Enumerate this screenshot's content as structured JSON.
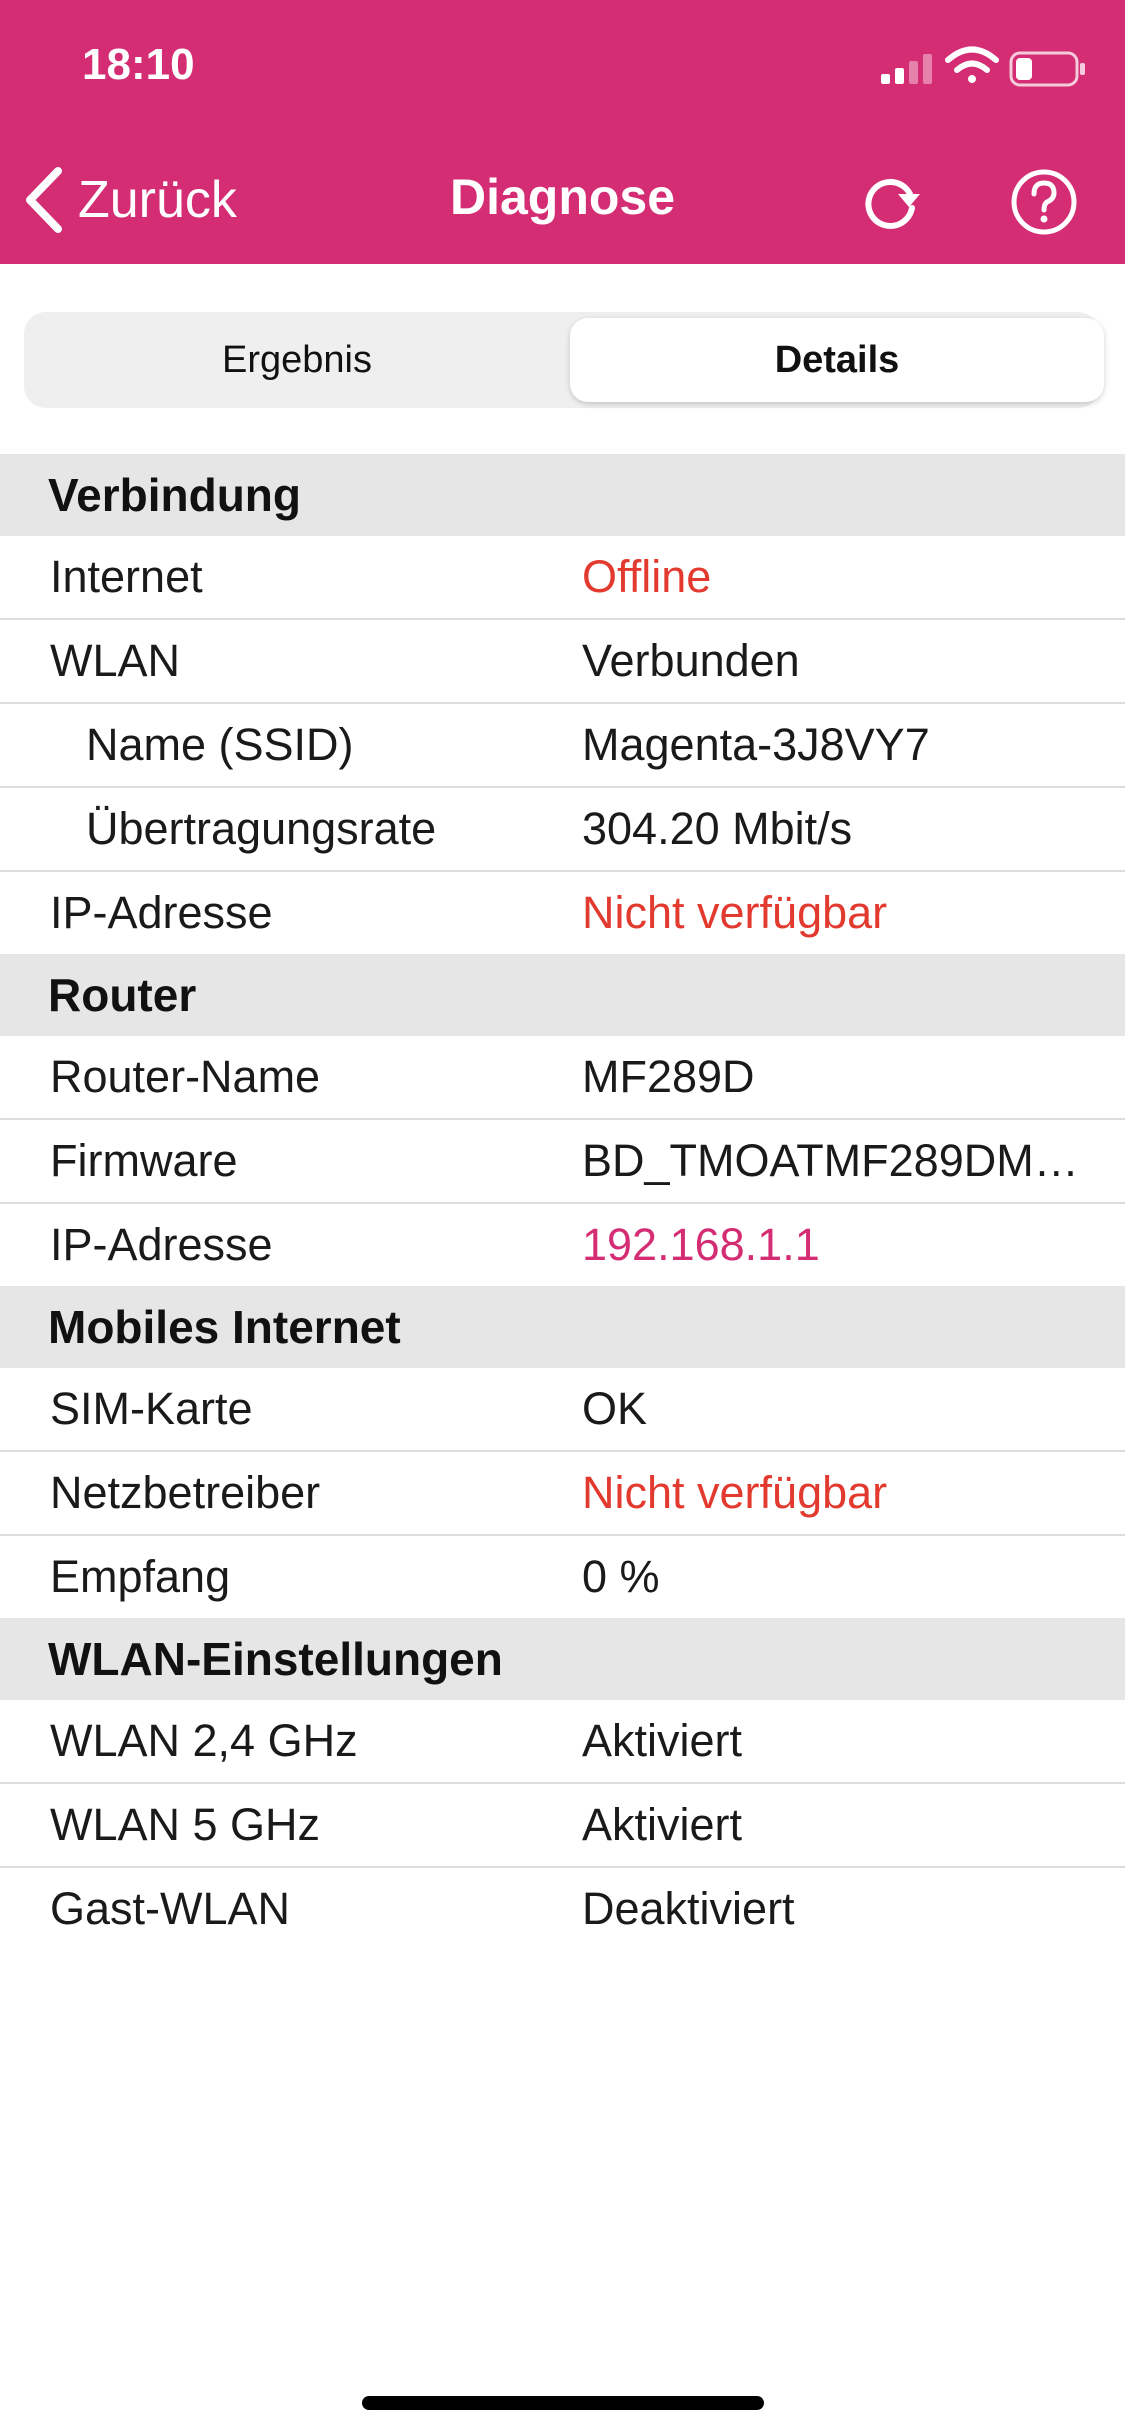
{
  "status_bar": {
    "time": "18:10"
  },
  "nav": {
    "back_label": "Zurück",
    "title": "Diagnose",
    "refresh_icon": "refresh-icon",
    "help_icon": "help-icon"
  },
  "tabs": [
    {
      "label": "Ergebnis",
      "selected": false
    },
    {
      "label": "Details",
      "selected": true
    }
  ],
  "colors": {
    "brand": "#d42d74",
    "error": "#e33a2f",
    "section_bg": "#e6e6e6"
  },
  "sections": [
    {
      "title": "Verbindung",
      "rows": [
        {
          "label": "Internet",
          "value": "Offline"
        },
        {
          "label": "WLAN",
          "value": "Verbunden"
        },
        {
          "label": "Name (SSID)",
          "value": "Magenta-3J8VY7"
        },
        {
          "label": "Übertragungsrate",
          "value": "304.20 Mbit/s"
        },
        {
          "label": "IP-Adresse",
          "value": "Nicht verfügbar"
        }
      ]
    },
    {
      "title": "Router",
      "rows": [
        {
          "label": "Router-Name",
          "value": "MF289D"
        },
        {
          "label": "Firmware",
          "value": "BD_TMOATMF289DM…"
        },
        {
          "label": "IP-Adresse",
          "value": "192.168.1.1"
        }
      ]
    },
    {
      "title": "Mobiles Internet",
      "rows": [
        {
          "label": "SIM-Karte",
          "value": "OK"
        },
        {
          "label": "Netzbetreiber",
          "value": "Nicht verfügbar"
        },
        {
          "label": "Empfang",
          "value": "0 %"
        }
      ]
    },
    {
      "title": "WLAN-Einstellungen",
      "rows": [
        {
          "label": "WLAN 2,4 GHz",
          "value": "Aktiviert"
        },
        {
          "label": "WLAN 5 GHz",
          "value": "Aktiviert"
        },
        {
          "label": "Gast-WLAN",
          "value": "Deaktiviert"
        }
      ]
    }
  ]
}
